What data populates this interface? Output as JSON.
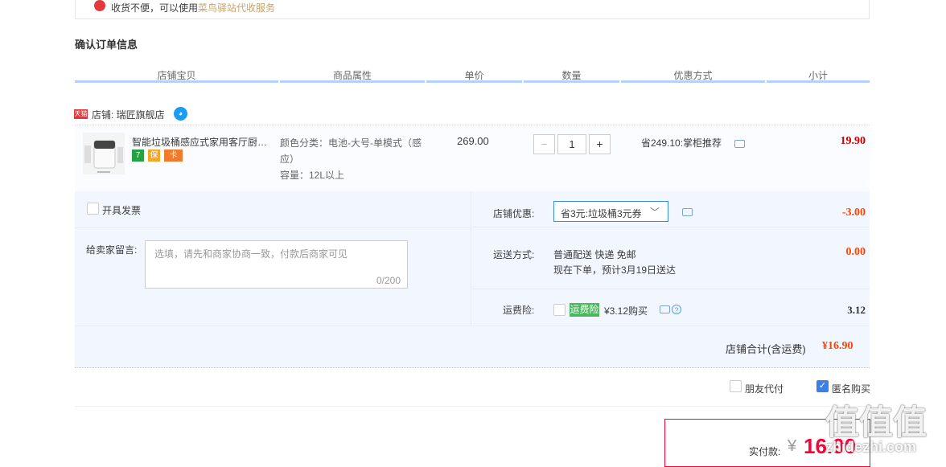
{
  "notice": {
    "text": "收货不便，可以使用",
    "link": "菜鸟驿站代收服务"
  },
  "section_title": "确认订单信息",
  "columns": [
    "店铺宝贝",
    "商品属性",
    "单价",
    "数量",
    "优惠方式",
    "小计"
  ],
  "shop": {
    "badge": "天猫",
    "name": "店铺: 瑞匠旗舰店"
  },
  "item": {
    "name": "智能垃圾桶感应式家用客厅厨房卫生间",
    "badges": [
      "7",
      "保",
      "卡"
    ],
    "attr_line1": "颜色分类：电池-大号-单模式（感应）",
    "attr_line2": "容量：12L以上",
    "unit_price": "269.00",
    "quantity": "1",
    "qty_minus": "−",
    "qty_plus": "+",
    "discount": "省249.10:掌柜推荐",
    "subtotal": "19.90"
  },
  "invoice": {
    "label": "开具发票"
  },
  "message": {
    "label": "给卖家留言:",
    "placeholder": "选填，请先和商家协商一致，付款后商家可见",
    "counter": "0/200"
  },
  "shop_discount": {
    "label": "店铺优惠:",
    "selected": "省3元:垃圾桶3元券",
    "amount": "-3.00"
  },
  "shipping": {
    "label": "运送方式:",
    "line1": "普通配送 快递 免邮",
    "line2": "现在下单，预计3月19日送达",
    "amount": "0.00"
  },
  "insurance": {
    "label": "运费险:",
    "tag": "运费险",
    "price": "¥3.12购买",
    "amount": "3.12"
  },
  "shop_total": {
    "label": "店铺合计(含运费)",
    "amount": "¥16.90"
  },
  "friend_pay": {
    "label": "朋友代付"
  },
  "anonymous": {
    "label": "匿名购买",
    "checked": true
  },
  "payment": {
    "label": "实付款:",
    "currency": "¥",
    "amount": "16.90"
  },
  "watermark": {
    "main": "值值值",
    "sub": "zhidezhi.com"
  },
  "colors": {
    "accent_red": "#ff0036",
    "header_line": "#b2d1ff",
    "panel_bg": "#f2f7ff",
    "promo_green": "#4cb75f"
  }
}
